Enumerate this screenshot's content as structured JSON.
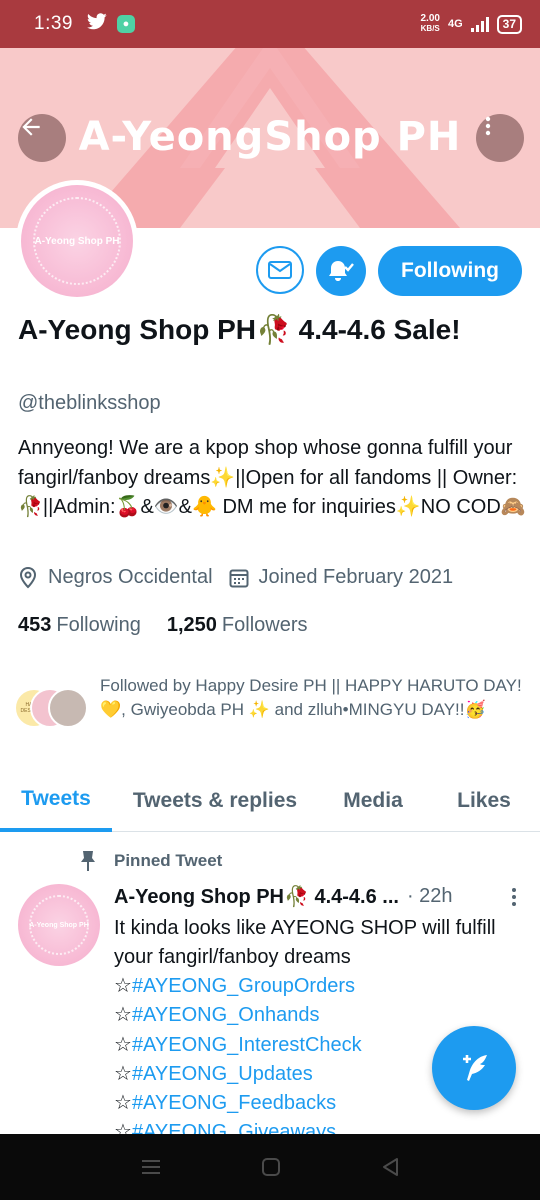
{
  "status_bar": {
    "time": "1:39",
    "speed_value": "2.00",
    "speed_unit": "KB/S",
    "network": "4G",
    "battery": "37"
  },
  "banner": {
    "title": "A-YeongShop PH",
    "bg_color": "#f8c9c9"
  },
  "profile": {
    "avatar_text": "A-Yeong Shop PH",
    "follow_button_label": "Following",
    "name": "A-Yeong Shop PH🥀 4.4-4.6 Sale!",
    "handle": "@theblinksshop",
    "bio": "Annyeong! We are a kpop shop whose gonna fulfill your fangirl/fanboy dreams✨||Open for all fandoms || Owner:🥀||Admin:🍒&👁️&🐥 DM me for inquiries✨NO COD🙈",
    "location": "Negros Occidental",
    "joined": "Joined February 2021",
    "following_count": "453",
    "following_label": "Following",
    "followers_count": "1,250",
    "followers_label": "Followers",
    "followed_by": "Followed by Happy Desire PH || HAPPY HARUTO DAY!💛, Gwiyeobda PH ✨ and zlluh•MINGYU DAY!!🥳",
    "followed_by_avatar_text": "HAPPY DESIRE PH"
  },
  "tabs": [
    {
      "label": "Tweets",
      "active": true
    },
    {
      "label": "Tweets & replies",
      "active": false
    },
    {
      "label": "Media",
      "active": false
    },
    {
      "label": "Likes",
      "active": false
    }
  ],
  "pinned_tweet": {
    "pinned_label": "Pinned Tweet",
    "avatar_text": "A-Yeong Shop PH",
    "author": "A-Yeong Shop PH🥀 4.4-4.6 ...",
    "time": "· 22h",
    "text": "It kinda looks like  AYEONG SHOP will fulfill your fangirl/fanboy dreams",
    "bullet": "☆",
    "hashtags": [
      "#AYEONG_GroupOrders",
      "#AYEONG_Onhands",
      "#AYEONG_InterestCheck",
      "#AYEONG_Updates",
      "#AYEONG_Feedbacks",
      "#AYEONG_Giveaways"
    ]
  },
  "colors": {
    "accent": "#1d9bf0",
    "status_bar": "#a93a3f",
    "secondary_text": "#536471"
  },
  "icons": [
    "back-arrow-icon",
    "more-vertical-icon",
    "mail-icon",
    "bell-check-icon",
    "location-icon",
    "calendar-icon",
    "pin-icon",
    "compose-icon",
    "menu-icon",
    "home-icon",
    "back-nav-icon"
  ]
}
